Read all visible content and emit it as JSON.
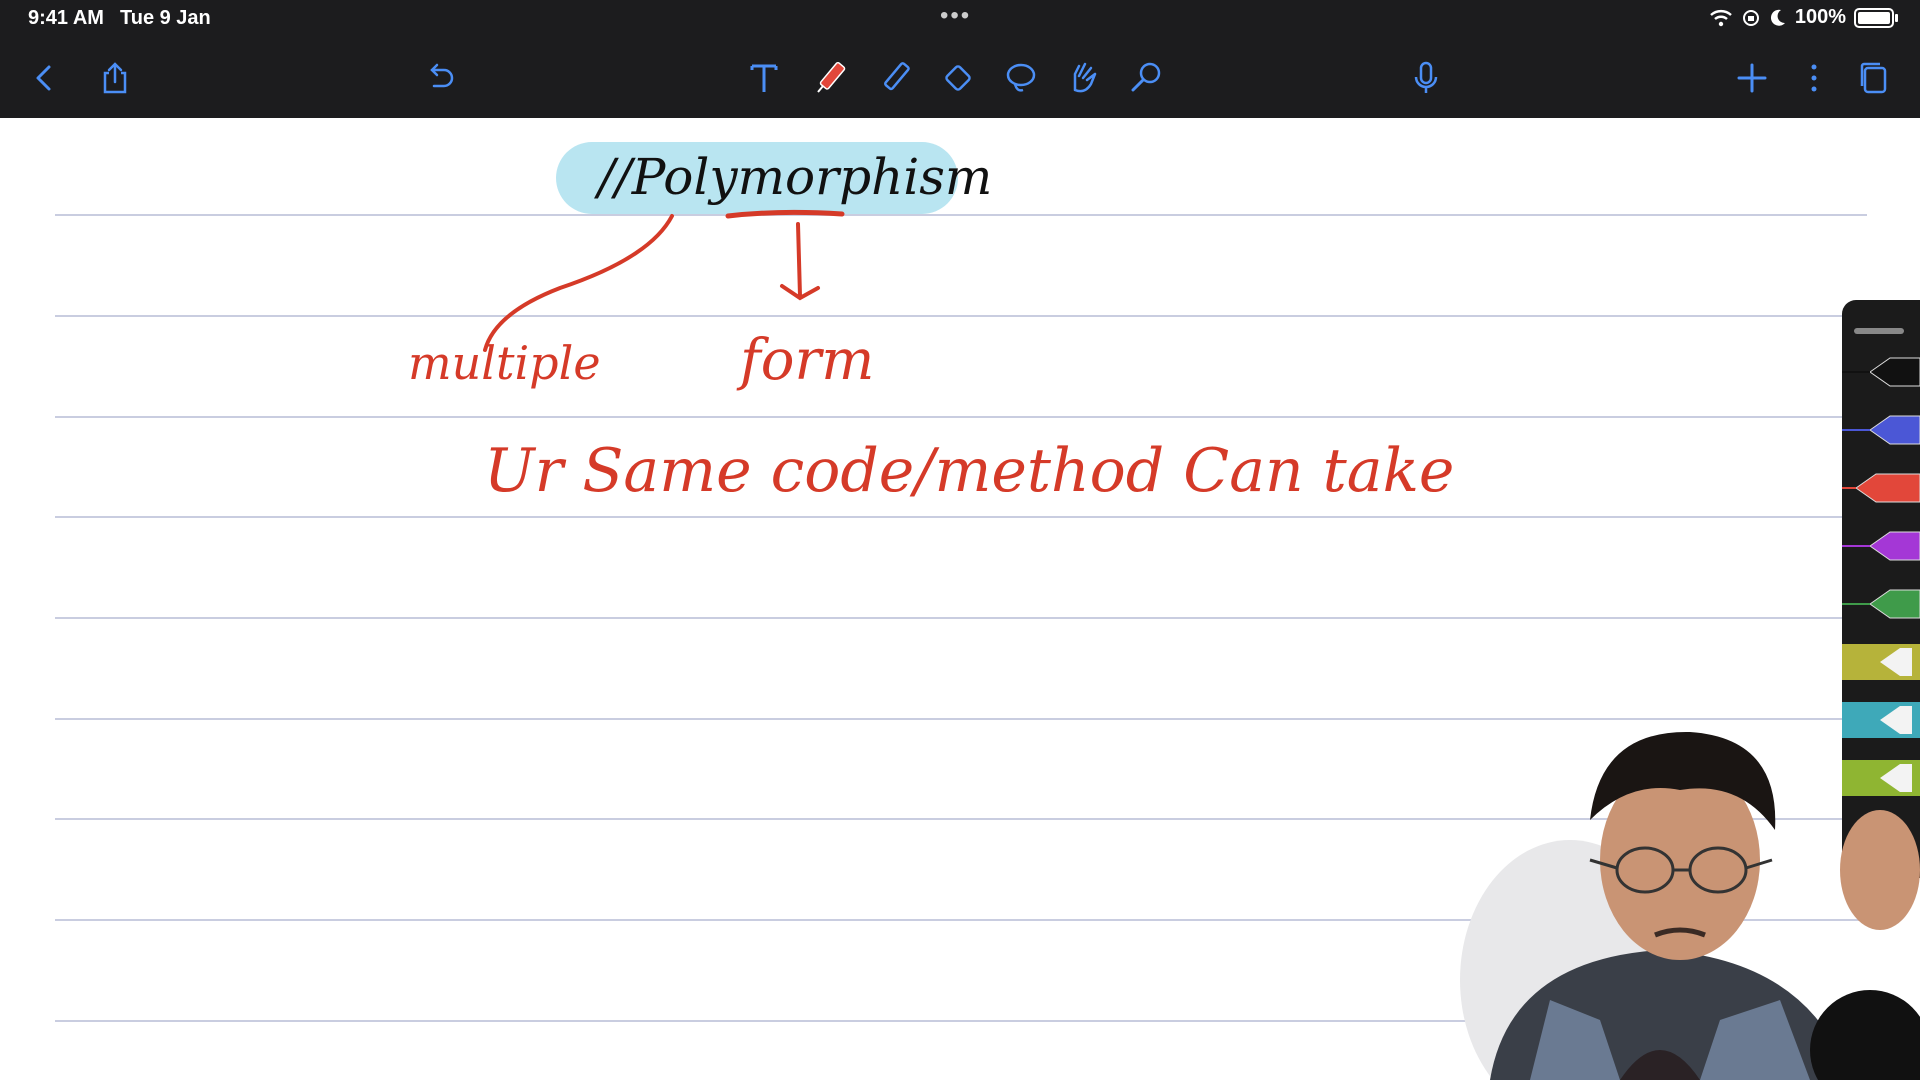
{
  "status_bar": {
    "time": "9:41 AM",
    "date": "Tue 9 Jan",
    "battery": "100%",
    "battery_level": 1.0
  },
  "toolbar": {
    "left": [
      "back-icon",
      "share-icon",
      "undo-icon"
    ],
    "tools": [
      "text-tool-icon",
      "pen-tool-icon",
      "pencil-tool-icon",
      "eraser-icon",
      "lasso-icon",
      "hand-pointer-icon",
      "laser-pointer-icon"
    ],
    "active_tool": "pen-tool-icon",
    "right": [
      "microphone-icon",
      "add-icon",
      "more-icon",
      "pages-icon"
    ]
  },
  "note": {
    "title": "//Polymorphism",
    "word_poly_meaning": "multiple",
    "word_morph_meaning": "form",
    "definition": "Ur Same code/method Can take",
    "colors": {
      "ink_black": "#111111",
      "ink_red": "#d53a28",
      "highlight_blue": "#b9e5f1",
      "rule_line": "#c9cde0"
    }
  },
  "pen_palette": [
    {
      "type": "pen",
      "color": "#111111"
    },
    {
      "type": "pen",
      "color": "#4b57d6"
    },
    {
      "type": "pen",
      "color": "#e2473a",
      "selected": true
    },
    {
      "type": "pen",
      "color": "#a437d6"
    },
    {
      "type": "pen",
      "color": "#3f9b4a"
    },
    {
      "type": "highlighter",
      "color": "#b6b33a"
    },
    {
      "type": "highlighter",
      "color": "#3ea9b9"
    },
    {
      "type": "highlighter",
      "color": "#8fb532"
    }
  ]
}
